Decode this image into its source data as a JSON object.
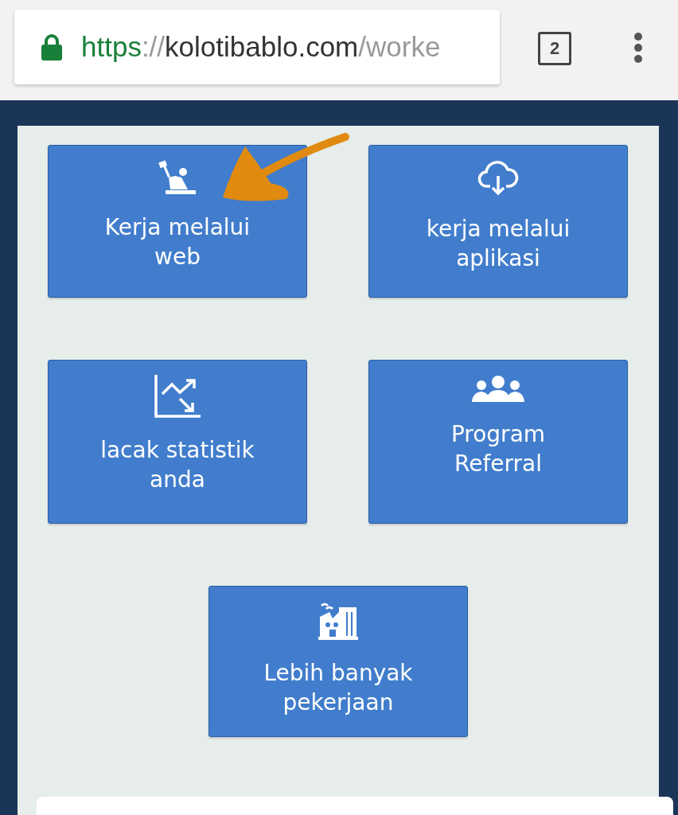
{
  "browser": {
    "secure": true,
    "url": {
      "scheme": "https",
      "separator": "://",
      "host": "kolotibablo.com",
      "path": "/worke"
    },
    "tab_count": "2"
  },
  "tiles": [
    {
      "kind": "worker",
      "label": "Kerja melalui web",
      "annotated": true
    },
    {
      "kind": "cloud",
      "label": "kerja melalui aplikasi",
      "annotated": false
    },
    {
      "kind": "chart",
      "label": "lacak statistik anda",
      "annotated": false
    },
    {
      "kind": "people",
      "label": "Program Referral",
      "annotated": false
    },
    {
      "kind": "factory",
      "label": "Lebih banyak pekerjaan",
      "annotated": false
    }
  ]
}
